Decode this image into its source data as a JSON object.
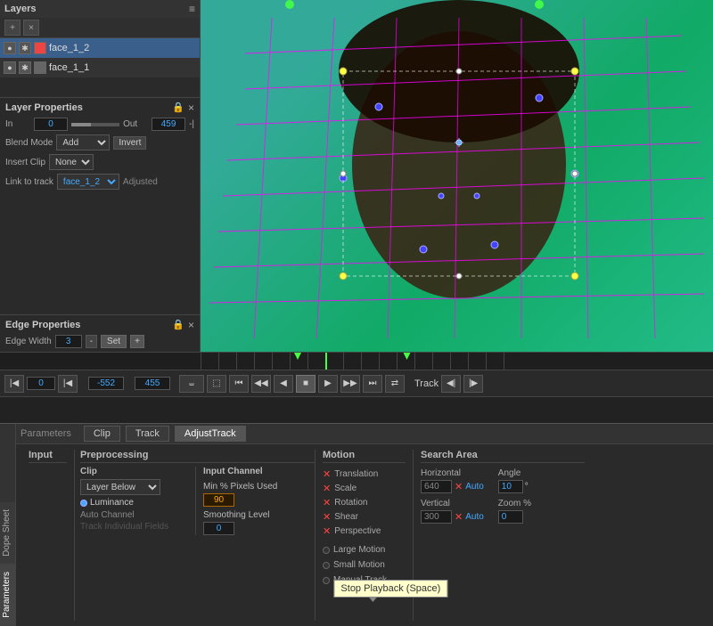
{
  "layers": {
    "title": "Layers",
    "items": [
      {
        "name": "face_1_2",
        "selected": true,
        "color": "#e44"
      },
      {
        "name": "face_1_1",
        "selected": false,
        "color": "#666"
      }
    ]
  },
  "layer_properties": {
    "title": "Layer Properties",
    "in_label": "In",
    "in_value": "0",
    "out_label": "Out",
    "out_value": "459",
    "blend_mode_label": "Blend Mode",
    "blend_mode_value": "Add",
    "invert_label": "Invert",
    "insert_clip_label": "Insert Clip",
    "insert_clip_value": "None",
    "link_track_label": "Link to track",
    "link_track_value": "face_1_2",
    "adjusted_label": "Adjusted"
  },
  "edge_properties": {
    "title": "Edge Properties",
    "edge_width_label": "Edge Width",
    "edge_width_value": "3",
    "set_label": "Set",
    "plus_label": "+"
  },
  "transport": {
    "track_label": "Track",
    "frame_value": "-552",
    "tooltip": "Stop Playback (Space)"
  },
  "parameters": {
    "section_label": "Parameters",
    "tabs": [
      "Clip",
      "Track",
      "AdjustTrack"
    ],
    "active_tab": "AdjustTrack",
    "input_label": "Input",
    "preprocessing_label": "Preprocessing",
    "motion_label": "Motion",
    "search_area_label": "Search Area",
    "clip_label": "Clip",
    "input_channel_label": "Input Channel",
    "min_pixels_label": "Min % Pixels Used",
    "min_pixels_value": "90",
    "smoothing_label": "Smoothing Level",
    "smoothing_value": "0",
    "luminance_label": "Luminance",
    "auto_channel_label": "Auto Channel",
    "motion_items": [
      "Translation",
      "Scale",
      "Rotation",
      "Shear",
      "Perspective"
    ],
    "large_motion_label": "Large Motion",
    "small_motion_label": "Small Motion",
    "manual_track_label": "Manual Track",
    "horizontal_label": "Horizontal",
    "horizontal_value": "640",
    "horizontal_auto": "Auto",
    "angle_label": "Angle",
    "angle_value": "10",
    "angle_unit": "°",
    "vertical_label": "Vertical",
    "vertical_value": "300",
    "vertical_auto": "Auto",
    "zoom_label": "Zoom %",
    "zoom_value": "0",
    "layer_below_label": "Layer Below",
    "layer_below_dropdown": "Layer Below",
    "track_individual_label": "Track Individual Fields"
  },
  "side_tabs": [
    "Dope Sheet",
    "Parameters"
  ]
}
